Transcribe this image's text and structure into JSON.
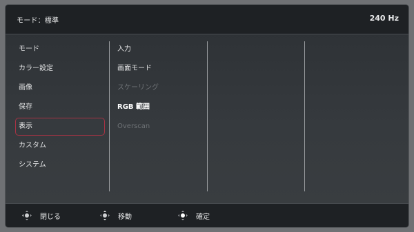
{
  "header": {
    "mode_label": "モード：標準",
    "refresh_rate": "240 Hz"
  },
  "menu": {
    "items": [
      {
        "label": "モード"
      },
      {
        "label": "カラー設定"
      },
      {
        "label": "画像"
      },
      {
        "label": "保存"
      },
      {
        "label": "表示",
        "selected": true
      },
      {
        "label": "カスタム"
      },
      {
        "label": "システム"
      }
    ]
  },
  "submenu": {
    "items": [
      {
        "label": "入力"
      },
      {
        "label": "画面モード"
      },
      {
        "label": "スケーリング",
        "state": "disabled"
      },
      {
        "label": "RGB 範囲",
        "state": "highlight"
      },
      {
        "label": "Overscan",
        "state": "disabled"
      }
    ]
  },
  "footer": {
    "hints": [
      {
        "icon": "joystick-left-icon",
        "label": "閉じる"
      },
      {
        "icon": "joystick-updown-icon",
        "label": "移動"
      },
      {
        "icon": "joystick-press-icon",
        "label": "確定"
      }
    ]
  },
  "colors": {
    "selection_border": "#a83344",
    "disabled_text": "#6e7276"
  }
}
